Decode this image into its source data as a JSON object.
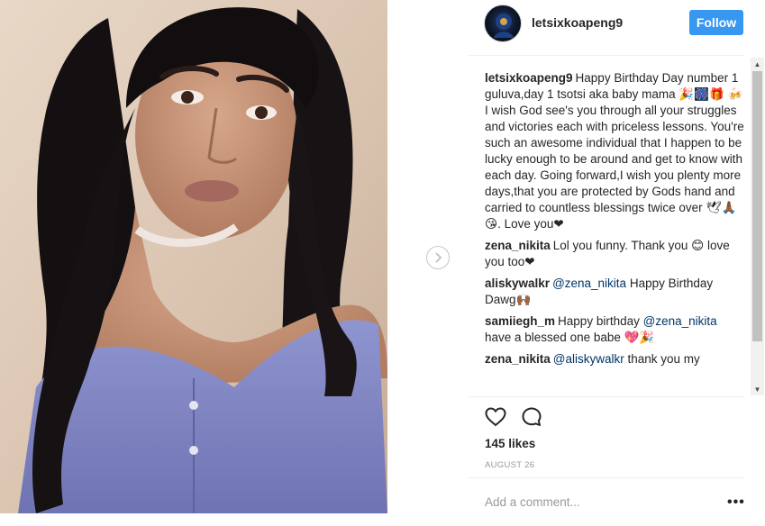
{
  "post": {
    "image_alt": "",
    "header": {
      "username": "letsixkoapeng9",
      "follow_label": "Follow"
    },
    "comments": [
      {
        "author": "letsixkoapeng9",
        "parts": [
          {
            "t": "Happy Birthday Day number 1 guluva,day 1 tsotsi aka baby mama 🎉🎆🎁 🍻I wish God see's you through all your struggles and victories each with priceless lessons. You're such an awesome individual that I happen to be lucky enough to be around and get to know with each day. Going forward,I wish you plenty more days,that you are protected by Gods hand and carried to countless blessings twice over 🕊🙏🏾😘. Love you❤"
          }
        ]
      },
      {
        "author": "zena_nikita",
        "parts": [
          {
            "t": "Lol you funny. Thank you 😊 love you too❤"
          }
        ]
      },
      {
        "author": "aliskywalkr",
        "parts": [
          {
            "m": "@zena_nikita"
          },
          {
            "t": " Happy Birthday Dawg🙌🏾"
          }
        ]
      },
      {
        "author": "samiiegh_m",
        "parts": [
          {
            "t": "Happy birthday "
          },
          {
            "m": "@zena_nikita"
          },
          {
            "t": " have a blessed one babe 💖🎉"
          }
        ]
      },
      {
        "author": "zena_nikita",
        "parts": [
          {
            "m": "@aliskywalkr"
          },
          {
            "t": " thank you my"
          }
        ]
      }
    ],
    "likes": "145 likes",
    "date": "AUGUST 26",
    "comment_placeholder": "Add a comment...",
    "more_label": "•••"
  },
  "colors": {
    "accent": "#3897f0",
    "mention": "#003569",
    "muted": "#999999"
  },
  "icons": {
    "like": "heart-outline-icon",
    "comment": "speech-bubble-icon",
    "next": "chevron-right-icon",
    "more": "ellipsis-icon"
  }
}
